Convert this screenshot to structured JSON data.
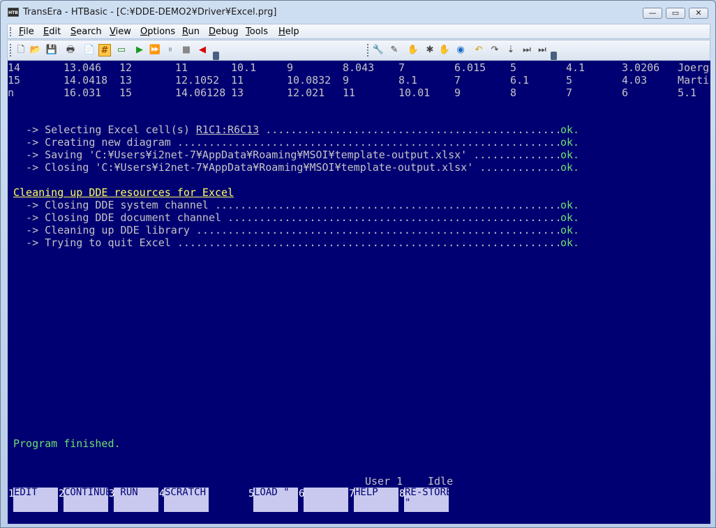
{
  "window": {
    "title": "TransEra - HTBasic - [C:¥DDE-DEMO2¥Driver¥Excel.prg]",
    "icon_label": "HTB",
    "minimize": "—",
    "maximize": "▭",
    "close": "✕"
  },
  "menu": [
    {
      "label": "File",
      "accel": "F",
      "rest": "ile"
    },
    {
      "label": "Edit",
      "accel": "E",
      "rest": "dit"
    },
    {
      "label": "Search",
      "accel": "S",
      "rest": "earch"
    },
    {
      "label": "View",
      "accel": "V",
      "rest": "iew"
    },
    {
      "label": "Options",
      "accel": "O",
      "rest": "ptions"
    },
    {
      "label": "Run",
      "accel": "R",
      "rest": "un"
    },
    {
      "label": "Debug",
      "accel": "D",
      "rest": "ebug"
    },
    {
      "label": "Tools",
      "accel": "T",
      "rest": "ools"
    },
    {
      "label": "Help",
      "accel": "H",
      "rest": "elp"
    }
  ],
  "table_rows": [
    [
      "14",
      "13.046",
      "12",
      "11",
      "10.1",
      "9",
      "8.043",
      "7",
      "6.015",
      "5",
      "4.1",
      "3.0206",
      "Joerg"
    ],
    [
      "15",
      "14.0418",
      "13",
      "12.1052",
      "11",
      "10.0832",
      "9",
      "8.1",
      "7",
      "6.1",
      "5",
      "4.03",
      "Marti"
    ],
    [
      "n",
      "16.031",
      "15",
      "14.06128",
      "13",
      "12.021",
      "11",
      "10.01",
      "9",
      "8",
      "7",
      "6",
      "5.1"
    ]
  ],
  "log1": [
    {
      "prefix": "  -> Selecting Excel cell(s) ",
      "ul": "R1C1:R6C13",
      "status": "ok."
    },
    {
      "prefix": "  -> Creating new diagram ",
      "ul": "",
      "status": "ok."
    },
    {
      "prefix": "  -> Saving 'C:¥Users¥i2net-7¥AppData¥Roaming¥MSOI¥template-output.xlsx' ",
      "ul": "",
      "status": "ok."
    },
    {
      "prefix": "  -> Closing 'C:¥Users¥i2net-7¥AppData¥Roaming¥MSOI¥template-output.xlsx' ",
      "ul": "",
      "status": "ok."
    }
  ],
  "cleanup_heading": "Cleaning up DDE resources for Excel",
  "log2": [
    {
      "prefix": "  -> Closing DDE system channel ",
      "status": "ok."
    },
    {
      "prefix": "  -> Closing DDE document channel ",
      "status": "ok."
    },
    {
      "prefix": "  -> Cleaning up DDE library ",
      "status": "ok."
    },
    {
      "prefix": "  -> Trying to quit Excel ",
      "status": "ok."
    }
  ],
  "program_finished": "Program finished.",
  "status_user": "User 1",
  "status_state": "Idle",
  "softkeys": [
    {
      "num": "1",
      "label": "EDIT"
    },
    {
      "num": "2",
      "label": "CONTINUE"
    },
    {
      "num": "3",
      "label": " RUN"
    },
    {
      "num": "4",
      "label": "SCRATCH"
    },
    {
      "num": "5",
      "label": "LOAD \""
    },
    {
      "num": "6",
      "label": ""
    },
    {
      "num": "7",
      "label": "HELP"
    },
    {
      "num": "8",
      "label": "RE-STORE\n\""
    }
  ],
  "toolbar_icons": [
    "new-file-icon",
    "open-folder-icon",
    "save-icon",
    "print-icon",
    "program-properties-icon",
    "line-numbers-icon",
    "screen-icon",
    "run-icon",
    "continue-icon",
    "pause-icon",
    "stop-icon",
    "step-back-icon",
    "wrench-icon",
    "debug-tools-icon",
    "hand-icon",
    "breakpoint-clear-icon",
    "watch-hand-icon",
    "globe-icon",
    "undo-icon",
    "redo-icon",
    "step-into-icon",
    "step-over-icon",
    "step-out-icon"
  ]
}
